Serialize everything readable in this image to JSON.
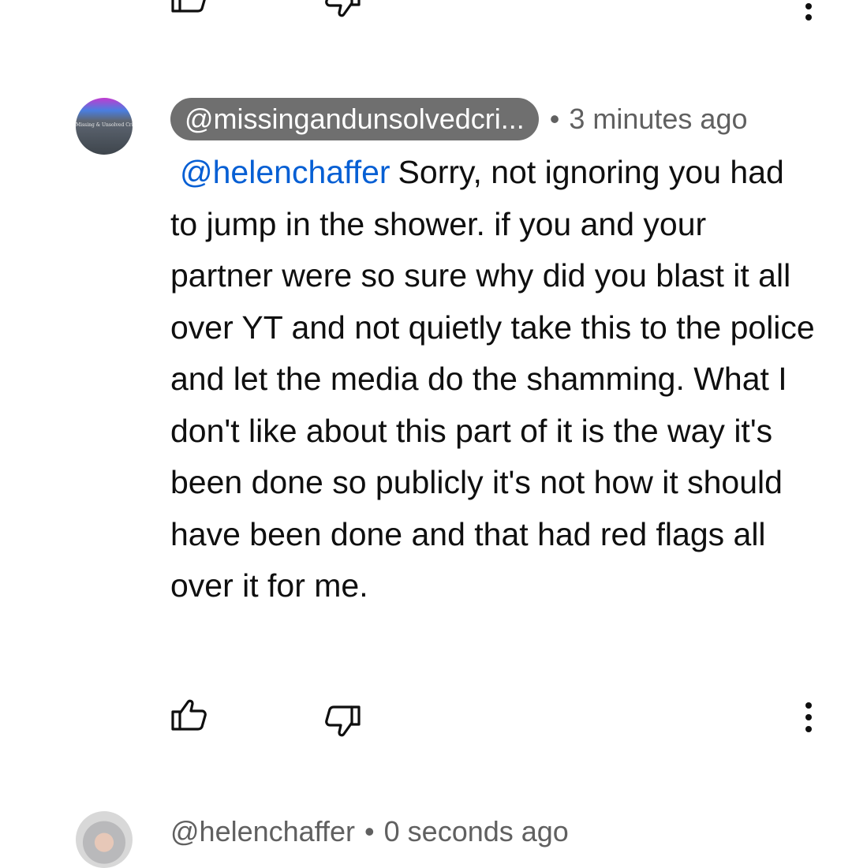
{
  "comments": [
    {
      "author": "@missingandunsolvedcri...",
      "avatar_text": "Missing & Unsolved Crime",
      "separator": "•",
      "time": "3 minutes ago",
      "mention": "@helenchaffer",
      "text": "Sorry, not ignoring you had to jump in the shower. if you and your partner were so sure why did you blast it all over YT and not quietly take this to the police and let the media do the shamming. What I don't like about this part of it is the way it's been done so publicly it's not how it should have been done and that had red flags all over it for me."
    },
    {
      "author": "@helenchaffer",
      "separator": "•",
      "time": "0 seconds ago"
    }
  ],
  "icons": {
    "like": "thumbs-up-icon",
    "dislike": "thumbs-down-icon",
    "more": "more-vertical-icon"
  },
  "colors": {
    "mention": "#065fd4",
    "handle_chip": "#6f6f6f",
    "meta_text": "#606060"
  }
}
